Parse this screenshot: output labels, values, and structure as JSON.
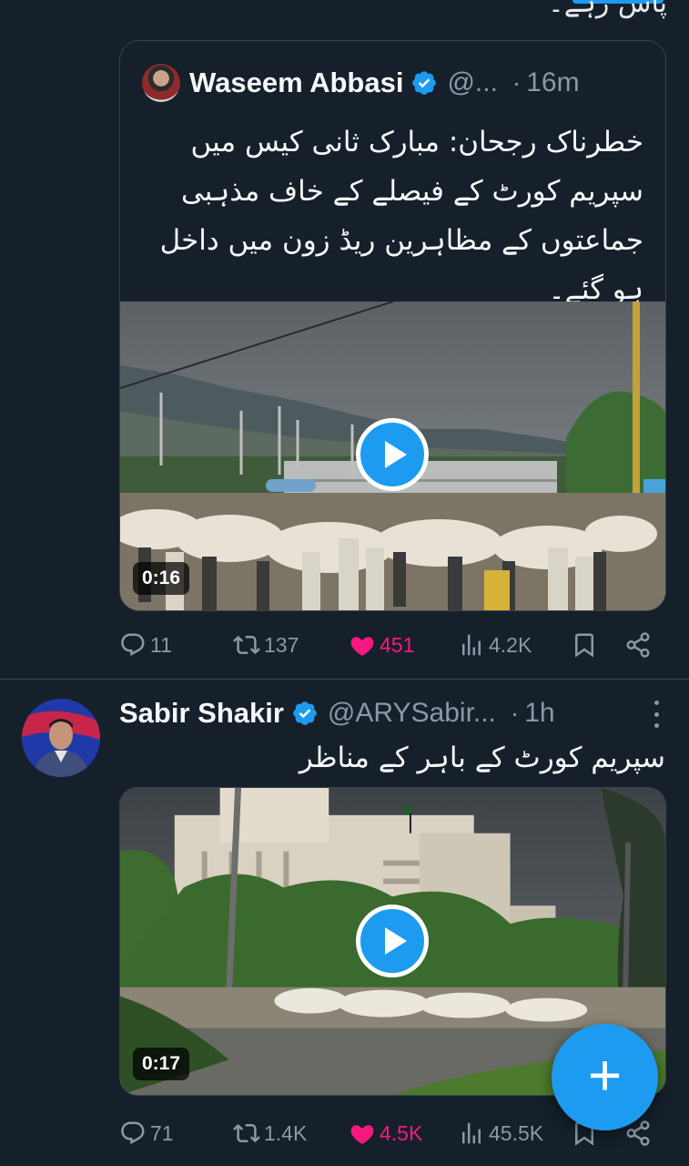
{
  "top_snippet": "پاس رہے۔",
  "quoted_tweet": {
    "author_name": "Waseem Abbasi",
    "handle": "@...",
    "dot": "·",
    "time": "16m",
    "text": "خطرناک رجحان: مبارک ثانی کیس میں سپریم کورٹ کے فیصلے کے خاف مذہبی جماعتوں کے مظاہرین ریڈ زون میں داخل ہو گئے۔",
    "video_duration": "0:16"
  },
  "first_actions": {
    "replies": "11",
    "reposts": "137",
    "likes": "451",
    "views": "4.2K"
  },
  "second_tweet": {
    "author_name": "Sabir Shakir",
    "handle": "@ARYSabir...",
    "dot": "·",
    "time": "1h",
    "text": "سپریم کورٹ کے باہر کے مناظر",
    "video_duration": "0:17"
  },
  "second_actions": {
    "replies": "71",
    "reposts": "1.4K",
    "likes": "4.5K",
    "views": "45.5K"
  },
  "fab_label": "+",
  "colors": {
    "background": "#15202b",
    "accent": "#1d9bf0",
    "like": "#f91880",
    "muted": "#8b98a5",
    "border": "#38444d"
  },
  "icons": [
    "reply-icon",
    "repost-icon",
    "heart-icon",
    "views-icon",
    "bookmark-icon",
    "share-icon",
    "verified-badge-icon",
    "play-icon",
    "more-icon",
    "plus-icon"
  ]
}
